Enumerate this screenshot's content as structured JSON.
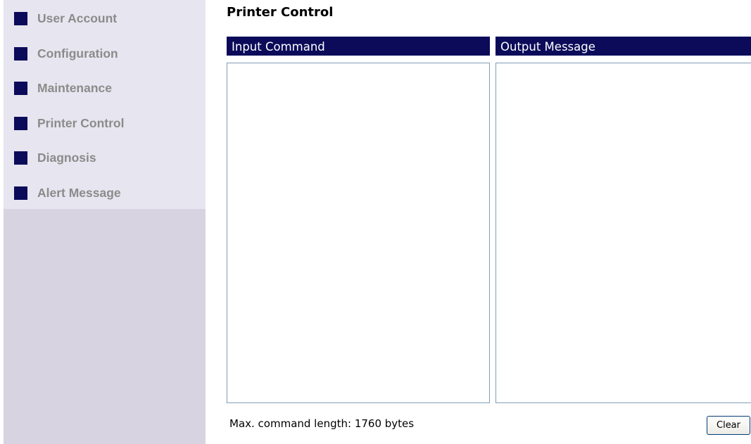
{
  "sidebar": {
    "items": [
      {
        "label": "User Account"
      },
      {
        "label": "Configuration"
      },
      {
        "label": "Maintenance"
      },
      {
        "label": "Printer Control"
      },
      {
        "label": "Diagnosis"
      },
      {
        "label": "Alert Message"
      }
    ]
  },
  "main": {
    "title": "Printer Control",
    "input_panel": {
      "header": "Input Command",
      "value": ""
    },
    "output_panel": {
      "header": "Output Message",
      "value": ""
    },
    "footer_note": "Max. command length: 1760 bytes",
    "clear_label": "Clear"
  },
  "colors": {
    "accent": "#0b0b5a",
    "sidebar_menu_bg": "#e7e5ef",
    "sidebar_bg": "#d8d3e1",
    "menu_text": "#8b8b8b",
    "box_border": "#7f9db9"
  }
}
